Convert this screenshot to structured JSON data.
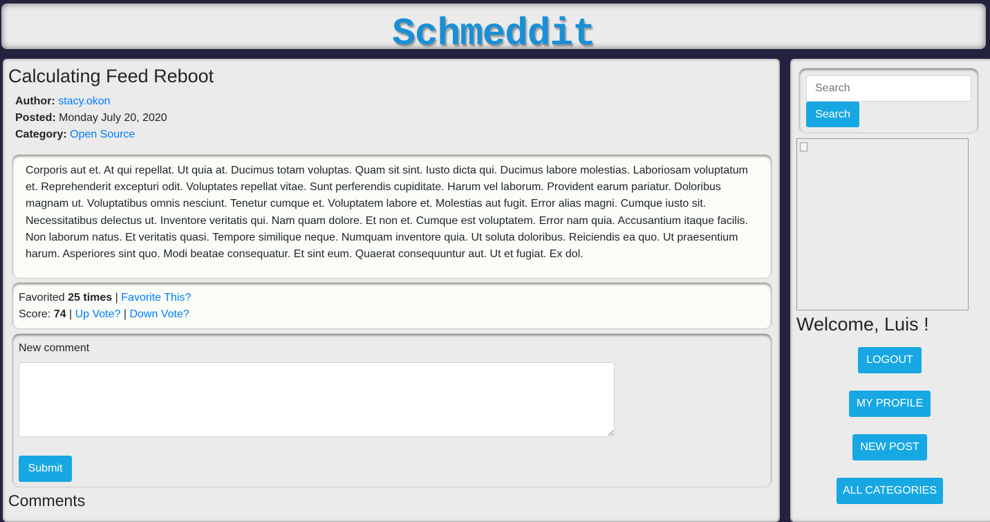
{
  "site": {
    "title": "Schmeddit"
  },
  "post": {
    "title": "Calculating Feed Reboot",
    "author_label": "Author:",
    "author": "stacy.okon",
    "posted_label": "Posted:",
    "posted": "Monday July 20, 2020",
    "category_label": "Category:",
    "category": "Open Source",
    "body": "Corporis aut et. At qui repellat. Ut quia at. Ducimus totam voluptas. Quam sit sint. Iusto dicta qui. Ducimus labore molestias. Laboriosam voluptatum et. Reprehenderit excepturi odit. Voluptates repellat vitae. Sunt perferendis cupiditate. Harum vel laborum. Provident earum pariatur. Doloribus magnam ut. Voluptatibus omnis nesciunt. Tenetur cumque et. Voluptatem labore et. Molestias aut fugit. Error alias magni. Cumque iusto sit. Necessitatibus delectus ut. Inventore veritatis qui. Nam quam dolore. Et non et. Cumque est voluptatem. Error nam quia. Accusantium itaque facilis. Non laborum natus. Et veritatis quasi. Tempore similique neque. Numquam inventore quia. Ut soluta doloribus. Reiciendis ea quo. Ut praesentium harum. Asperiores sint quo. Modi beatae consequatur. Et sint eum. Quaerat consequuntur aut. Ut et fugiat. Ex dol."
  },
  "stats": {
    "favorited_label": "Favorited",
    "favorited_count": "25 times",
    "separator": "|",
    "favorite_link": "Favorite This?",
    "score_label": "Score:",
    "score": "74",
    "upvote_link": "Up Vote?",
    "downvote_link": "Down Vote?"
  },
  "comment_form": {
    "label": "New comment",
    "textarea_value": "",
    "submit_label": "Submit"
  },
  "comments": {
    "heading": "Comments"
  },
  "sidebar": {
    "search_placeholder": "Search",
    "search_button": "Search",
    "welcome": "Welcome, Luis !",
    "buttons": {
      "logout": "LOGOUT",
      "my_profile": "MY PROFILE",
      "new_post": "NEW POST",
      "all_categories": "ALL CATEGORIES"
    }
  },
  "colors": {
    "accent": "#17a8e3",
    "link": "#007bff",
    "title": "#1a8fd6",
    "page_background": "#23223f",
    "panel": "#ebebeb"
  }
}
